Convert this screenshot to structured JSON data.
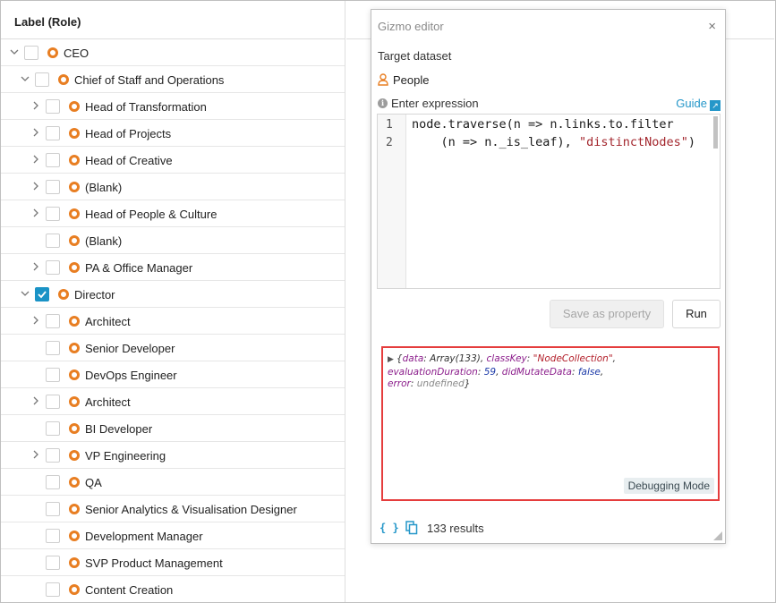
{
  "tree": {
    "header": "Label (Role)",
    "rows": [
      {
        "label": "CEO",
        "level": 0,
        "expand": "open",
        "checked": false
      },
      {
        "label": "Chief of Staff and Operations",
        "level": 1,
        "expand": "open",
        "checked": false
      },
      {
        "label": "Head of Transformation",
        "level": 2,
        "expand": "closed",
        "checked": false
      },
      {
        "label": "Head of Projects",
        "level": 2,
        "expand": "closed",
        "checked": false
      },
      {
        "label": "Head of Creative",
        "level": 2,
        "expand": "closed",
        "checked": false
      },
      {
        "label": "(Blank)",
        "level": 2,
        "expand": "closed",
        "checked": false
      },
      {
        "label": "Head of People & Culture",
        "level": 2,
        "expand": "closed",
        "checked": false
      },
      {
        "label": "(Blank)",
        "level": 2,
        "expand": "none",
        "checked": false
      },
      {
        "label": "PA & Office Manager",
        "level": 2,
        "expand": "closed",
        "checked": false
      },
      {
        "label": "Director",
        "level": 1,
        "expand": "open",
        "checked": true
      },
      {
        "label": "Architect",
        "level": 2,
        "expand": "closed",
        "checked": false
      },
      {
        "label": "Senior Developer",
        "level": 2,
        "expand": "none",
        "checked": false
      },
      {
        "label": "DevOps Engineer",
        "level": 2,
        "expand": "none",
        "checked": false
      },
      {
        "label": "Architect",
        "level": 2,
        "expand": "closed",
        "checked": false
      },
      {
        "label": "BI Developer",
        "level": 2,
        "expand": "none",
        "checked": false
      },
      {
        "label": "VP Engineering",
        "level": 2,
        "expand": "closed",
        "checked": false
      },
      {
        "label": "QA",
        "level": 2,
        "expand": "none",
        "checked": false
      },
      {
        "label": "Senior Analytics & Visualisation Designer",
        "level": 2,
        "expand": "none",
        "checked": false
      },
      {
        "label": "Development Manager",
        "level": 2,
        "expand": "none",
        "checked": false
      },
      {
        "label": "SVP Product Management",
        "level": 2,
        "expand": "none",
        "checked": false
      },
      {
        "label": "Content Creation",
        "level": 2,
        "expand": "none",
        "checked": false
      }
    ]
  },
  "gizmo": {
    "title": "Gizmo editor",
    "close_label": "×",
    "target_dataset_label": "Target dataset",
    "dataset_name": "People",
    "expression_label": "Enter expression",
    "guide_label": "Guide",
    "code_lines": [
      {
        "number": "1",
        "text": "node.traverse(n => n.links.to.filter"
      },
      {
        "number": "2",
        "text": "    (n => n._is_leaf), \"distinctNodes\")"
      }
    ],
    "save_button": "Save as property",
    "run_button": "Run",
    "console": {
      "caret": "▶",
      "tokens": [
        {
          "t": "{",
          "c": ""
        },
        {
          "t": "data",
          "c": "k"
        },
        {
          "t": ": Array(133), ",
          "c": ""
        },
        {
          "t": "classKey",
          "c": "k"
        },
        {
          "t": ": ",
          "c": ""
        },
        {
          "t": "\"NodeCollection\"",
          "c": "s"
        },
        {
          "t": ",",
          "c": ""
        },
        {
          "t": "\n",
          "c": "br"
        },
        {
          "t": "evaluationDuration",
          "c": "k"
        },
        {
          "t": ": ",
          "c": ""
        },
        {
          "t": "59",
          "c": "n"
        },
        {
          "t": ", ",
          "c": ""
        },
        {
          "t": "didMutateData",
          "c": "k"
        },
        {
          "t": ": ",
          "c": ""
        },
        {
          "t": "false",
          "c": "n"
        },
        {
          "t": ",",
          "c": ""
        },
        {
          "t": "\n",
          "c": "br"
        },
        {
          "t": "error",
          "c": "k"
        },
        {
          "t": ": ",
          "c": ""
        },
        {
          "t": "undefined",
          "c": "u"
        },
        {
          "t": "}",
          "c": ""
        }
      ],
      "debug_badge": "Debugging Mode"
    },
    "footer": {
      "code_icon": "{ }",
      "results": "133 results"
    }
  },
  "colors": {
    "accent": "#2597c9",
    "node_icon": "#e87e22",
    "checkbox_checked": "#1a93c6",
    "highlight_border": "#e53d3d"
  }
}
